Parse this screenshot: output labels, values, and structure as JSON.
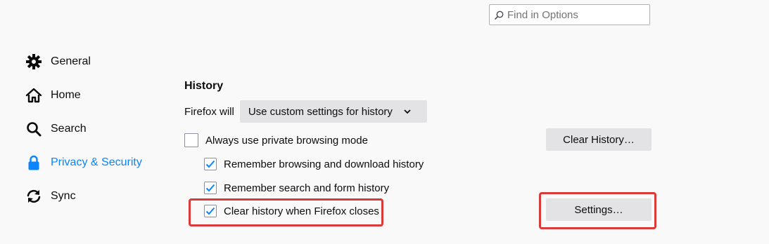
{
  "search": {
    "placeholder": "Find in Options",
    "icon": "search-icon"
  },
  "sidebar": {
    "items": [
      {
        "label": "General",
        "icon": "gear-icon",
        "selected": false
      },
      {
        "label": "Home",
        "icon": "home-icon",
        "selected": false
      },
      {
        "label": "Search",
        "icon": "magnifier-icon",
        "selected": false
      },
      {
        "label": "Privacy & Security",
        "icon": "lock-icon",
        "selected": true
      },
      {
        "label": "Sync",
        "icon": "sync-icon",
        "selected": false
      }
    ]
  },
  "history": {
    "title": "History",
    "firefox_will_label": "Firefox will",
    "mode_selected": "Use custom settings for history",
    "options": [
      {
        "label": "Always use private browsing mode",
        "checked": false
      },
      {
        "label": "Remember browsing and download history",
        "checked": true
      },
      {
        "label": "Remember search and form history",
        "checked": true
      },
      {
        "label": "Clear history when Firefox closes",
        "checked": true,
        "highlighted": true
      }
    ],
    "clear_history_button": "Clear History…",
    "settings_button": "Settings…"
  },
  "colors": {
    "accent": "#0a84ff",
    "highlight": "#d93a3a",
    "button_bg": "#e3e3e5",
    "page_bg": "#f9f9fa"
  }
}
